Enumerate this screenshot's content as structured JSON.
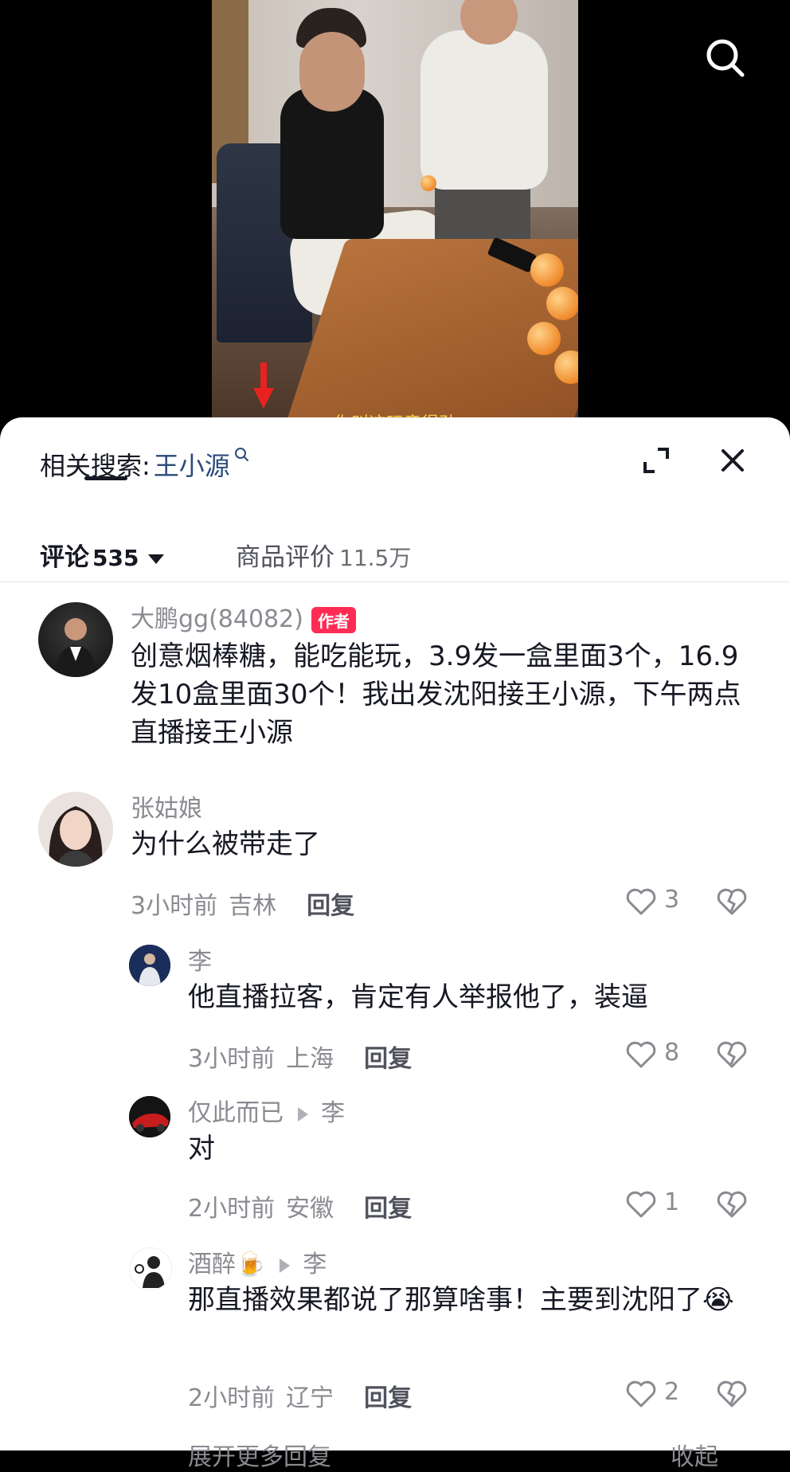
{
  "video": {
    "caption": "你叫这玩意得劲"
  },
  "sheet": {
    "related_search_label": "相关搜索:",
    "related_search_keyword": "王小源"
  },
  "tabs": [
    {
      "label": "评论",
      "count": "535"
    },
    {
      "label": "商品评价",
      "count": "11.5万"
    }
  ],
  "comments": [
    {
      "user": "大鹏gg(84082)",
      "badge": "作者",
      "text": "创意烟棒糖，能吃能玩，3.9发一盒里面3个，16.9发10盒里面30个！我出发沈阳接王小源，下午两点直播接王小源"
    },
    {
      "user": "张姑娘",
      "text": "为什么被带走了",
      "time": "3小时前",
      "location": "吉林",
      "reply_label": "回复",
      "likes": "3"
    },
    {
      "user": "李",
      "text": "他直播拉客，肯定有人举报他了，装逼",
      "time": "3小时前",
      "location": "上海",
      "reply_label": "回复",
      "likes": "8"
    },
    {
      "user": "仅此而已",
      "reply_to": "李",
      "text": "对",
      "time": "2小时前",
      "location": "安徽",
      "reply_label": "回复",
      "likes": "1"
    },
    {
      "user": "酒醉🍺",
      "reply_to": "李",
      "text": "那直播效果都说了那算啥事！主要到沈阳了😭",
      "time": "2小时前",
      "location": "辽宁",
      "reply_label": "回复",
      "likes": "2"
    }
  ],
  "footer": {
    "expand_more": "展开更多回复",
    "collapse": "收起"
  },
  "colors": {
    "author_badge": "#fe2c55",
    "keyword": "#2b4b7a",
    "meta_text": "#8a8b91"
  },
  "icons": [
    "search-icon",
    "expand-icon",
    "close-icon",
    "search-keyword-icon",
    "heart-icon",
    "broken-heart-icon",
    "down-arrow-icon"
  ]
}
